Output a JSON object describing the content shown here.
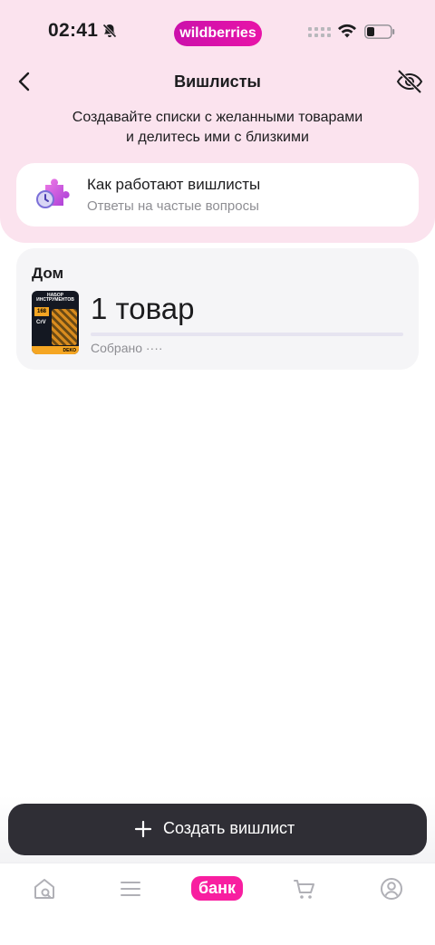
{
  "status_bar": {
    "time": "02:41",
    "brand": "wildberries"
  },
  "nav": {
    "title": "Вишлисты"
  },
  "intro": {
    "line1": "Создавайте списки с желанными товарами",
    "line2": "и делитесь ими с близкими"
  },
  "info_card": {
    "title": "Как работают вишлисты",
    "subtitle": "Ответы на частые вопросы"
  },
  "wishlists": [
    {
      "name": "Дом",
      "count_label": "1 товар",
      "collected_label": "Собрано ····",
      "progress": 0,
      "thumb": {
        "title": "НАБОР ИНСТРУМЕНТОВ",
        "badge": "168",
        "line": "CrV",
        "brand": "DEKO"
      }
    }
  ],
  "create_button": {
    "label": "Создать вишлист"
  },
  "tab_bar": {
    "bank_label": "банк"
  },
  "colors": {
    "top_bg": "#fbe3ee",
    "brand": "#cb11ab",
    "bank": "#f81ea0",
    "button_bg": "#2f2e35"
  }
}
